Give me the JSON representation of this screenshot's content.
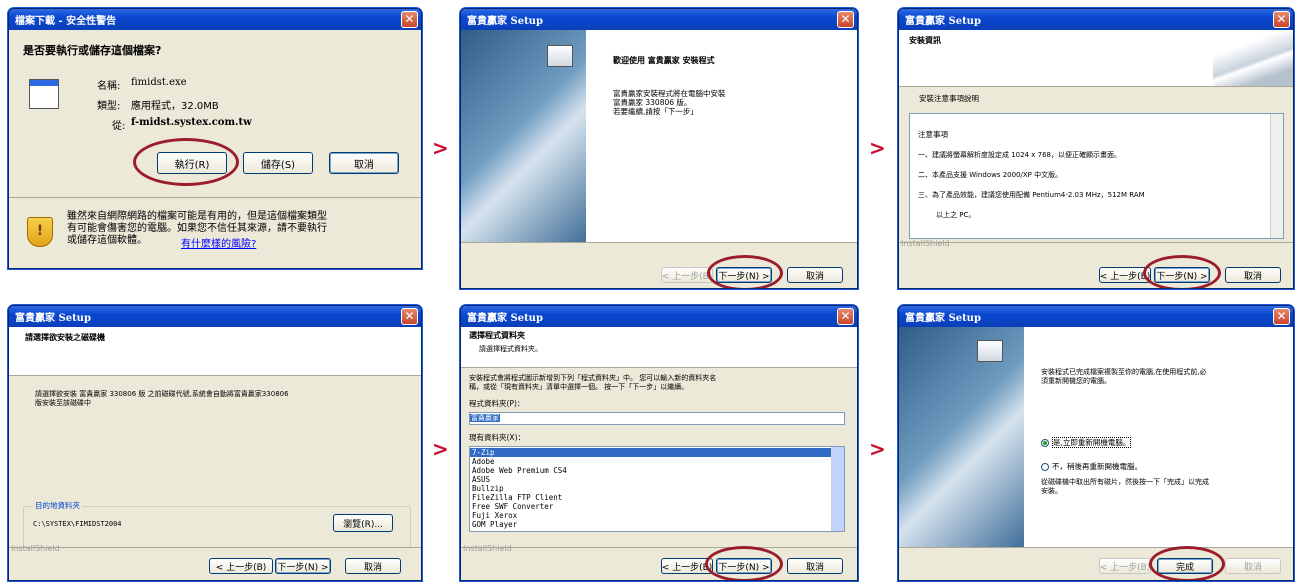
{
  "arrow_glyph": ">",
  "dl": {
    "title": "檔案下載 - 安全性警告",
    "question": "是否要執行或儲存這個檔案?",
    "name_label": "名稱:",
    "name_value": "fimidst.exe",
    "type_label": "類型:",
    "type_value": "應用程式，32.0MB",
    "from_label": "從:",
    "from_value": "f-midst.systex.com.tw",
    "run_button": "執行(R)",
    "save_button": "儲存(S)",
    "cancel_button": "取消",
    "warning_text": "雖然來自網際網路的檔案可能是有用的，但是這個檔案類型\n有可能會傷害您的電腦。如果您不信任其來源，請不要執行\n或儲存這個軟體。",
    "risk_link": "有什麼樣的風險?"
  },
  "w2": {
    "title": "富貴贏家 Setup",
    "welcome_title": "歡迎使用 富貴贏家 安裝程式",
    "welcome_body": "富貴贏家安裝程式將在電腦中安裝\n富貴贏家 330806 版。\n若要繼續,請按「下一步」",
    "back_button": "< 上一步(B)",
    "next_button": "下一步(N) >",
    "cancel_button": "取消"
  },
  "w3": {
    "title": "富貴贏家 Setup",
    "header_title": "安裝資訊",
    "subtitle": "安裝注意事項說明",
    "notes_title": "注意事項",
    "note1": "一、建議將螢幕解析度設定成 1024 x 768，以便正確顯示畫面。",
    "note2": "二、本產品支援 Windows 2000/XP 中文版。",
    "note3": "三、為了產品效能，建議您使用配備 Pentium4-2.03 MHz，512M RAM",
    "note3b": "以上之 PC。",
    "installshield": "InstallShield",
    "back_button": "< 上一步(B)",
    "next_button": "下一步(N) >",
    "cancel_button": "取消"
  },
  "w4": {
    "title": "富貴贏家 Setup",
    "header_title": "請選擇欲安裝之磁碟機",
    "body": "請選擇欲安裝 富貴贏家 330806 版 之前磁碟代號,系統會自動將富貴贏家330806\n版安裝至該磁碟中",
    "folder_label": "目的地資料夾",
    "folder_value": "C:\\SYSTEX\\FIMIDST2004",
    "browse_button": "瀏覽(R)...",
    "installshield": "InstallShield",
    "back_button": "< 上一步(B)",
    "next_button": "下一步(N) >",
    "cancel_button": "取消"
  },
  "w5": {
    "title": "富貴贏家 Setup",
    "header_title": "選擇程式資料夾",
    "header_sub": "請選擇程式資料夾。",
    "body": "安裝程式會將程式圖示新增到下列「程式資料夾」中。 您可以輸入新的資料夾名\n稱，或從「現有資料夾」清單中選擇一個。 按一下「下一步」以繼續。",
    "program_folder_label": "程式資料夾(P)：",
    "program_folder_value": "富貴贏家",
    "existing_label": "現有資料夾(X)：",
    "folders": [
      "7-Zip",
      "Adobe",
      "Adobe Web Premium CS4",
      "ASUS",
      "Bullzip",
      "FileZilla FTP Client",
      "Free SWF Converter",
      "Fuji Xerox",
      "GOM Player"
    ],
    "installshield": "InstallShield",
    "back_button": "< 上一步(B)",
    "next_button": "下一步(N) >",
    "cancel_button": "取消"
  },
  "w6": {
    "title": "富貴贏家 Setup",
    "body": "安裝程式已完成檔案複製至你的電腦,在使用程式前,必\n須重新開機您的電腦。",
    "opt_yes": "是,立即重新開機電腦。",
    "opt_no": "不，稍後再重新開機電腦。",
    "remove_text": "從磁碟機中取出所有磁片，然後按一下「完成」以完成\n安裝。",
    "back_button": "< 上一步(B)",
    "finish_button": "完成",
    "cancel_button": "取消"
  }
}
